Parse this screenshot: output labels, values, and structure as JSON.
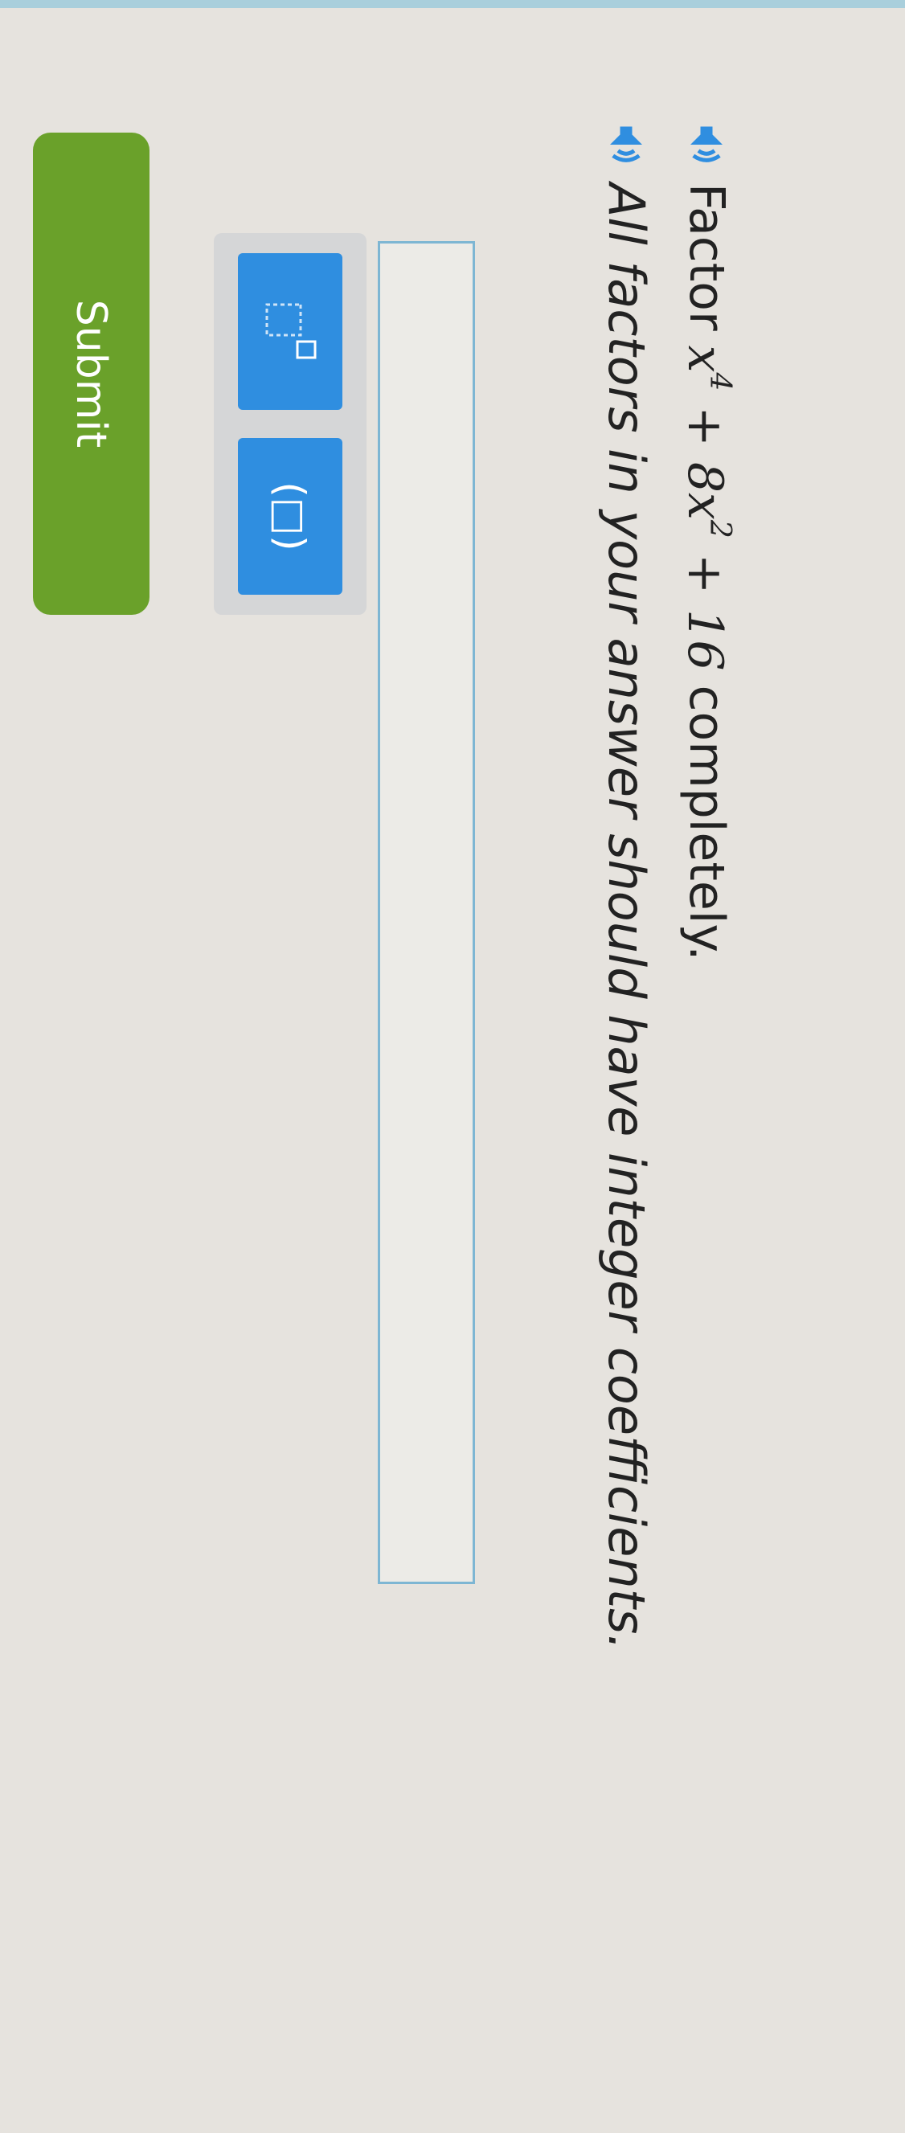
{
  "question": {
    "prefix": "Factor",
    "terms": [
      {
        "text": "x",
        "sup": "4"
      },
      {
        "text": " + 8x",
        "sup": "2"
      },
      {
        "text": " + 16",
        "sup": ""
      }
    ],
    "suffix": "completely.",
    "instruction": "All factors in your answer should have integer coefficients."
  },
  "toolbar": {
    "exponent_icon": "exponent-template-icon",
    "paren_label": "(□)"
  },
  "submit": {
    "label": "Submit"
  },
  "colors": {
    "accent_blue": "#2f8ee0",
    "submit_green": "#6aa12a",
    "input_border": "#7eb6d3"
  }
}
